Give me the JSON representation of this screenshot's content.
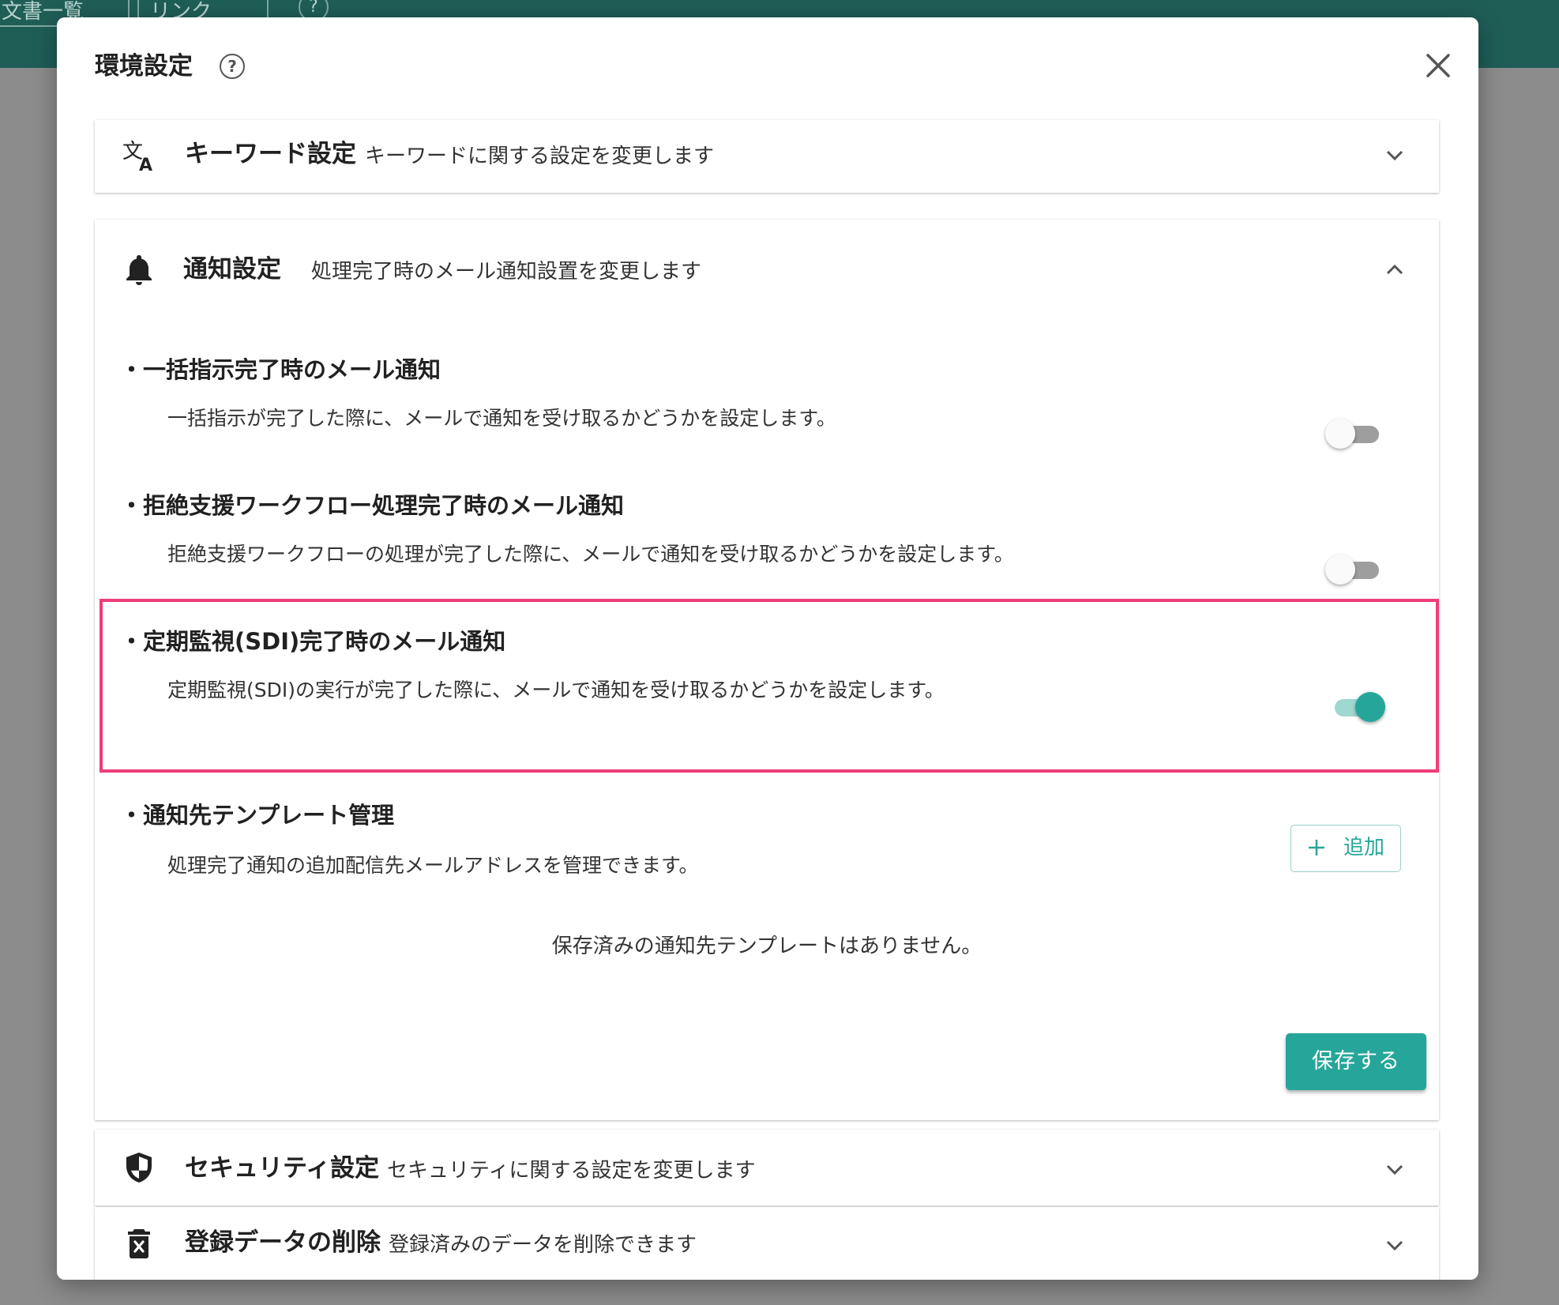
{
  "background_app": {
    "tabs": [
      "文書一覧",
      "リンク"
    ],
    "help_glyph": "?"
  },
  "dialog": {
    "title": "環境設定",
    "help_glyph": "?",
    "close_icon": "close-icon"
  },
  "sections": {
    "keyword": {
      "title": "キーワード設定",
      "description": "キーワードに関する設定を変更します",
      "icon": "translate-icon",
      "expanded": false
    },
    "notification": {
      "title": "通知設定",
      "description": "処理完了時のメール通知設置を変更します",
      "icon": "bell-icon",
      "expanded": true,
      "items": [
        {
          "title": "一括指示完了時のメール通知",
          "description": "一括指示が完了した際に、メールで通知を受け取るかどうかを設定します。",
          "enabled": false
        },
        {
          "title": "拒絶支援ワークフロー処理完了時のメール通知",
          "description": "拒絶支援ワークフローの処理が完了した際に、メールで通知を受け取るかどうかを設定します。",
          "enabled": false
        },
        {
          "title": "定期監視(SDI)完了時のメール通知",
          "description": "定期監視(SDI)の実行が完了した際に、メールで通知を受け取るかどうかを設定します。",
          "enabled": true
        }
      ],
      "template": {
        "title": "通知先テンプレート管理",
        "description": "処理完了通知の追加配信先メールアドレスを管理できます。",
        "add_label": "追加",
        "empty_message": "保存済みの通知先テンプレートはありません。"
      },
      "save_label": "保存する"
    },
    "security": {
      "title": "セキュリティ設定",
      "description": "セキュリティに関する設定を変更します",
      "icon": "shield-icon",
      "expanded": false
    },
    "delete_data": {
      "title": "登録データの削除",
      "description": "登録済みのデータを削除できます",
      "icon": "delete-icon",
      "expanded": false
    }
  },
  "colors": {
    "accent": "#26a69a",
    "highlight": "#ef3d78",
    "app_bar": "#1f5e57"
  }
}
